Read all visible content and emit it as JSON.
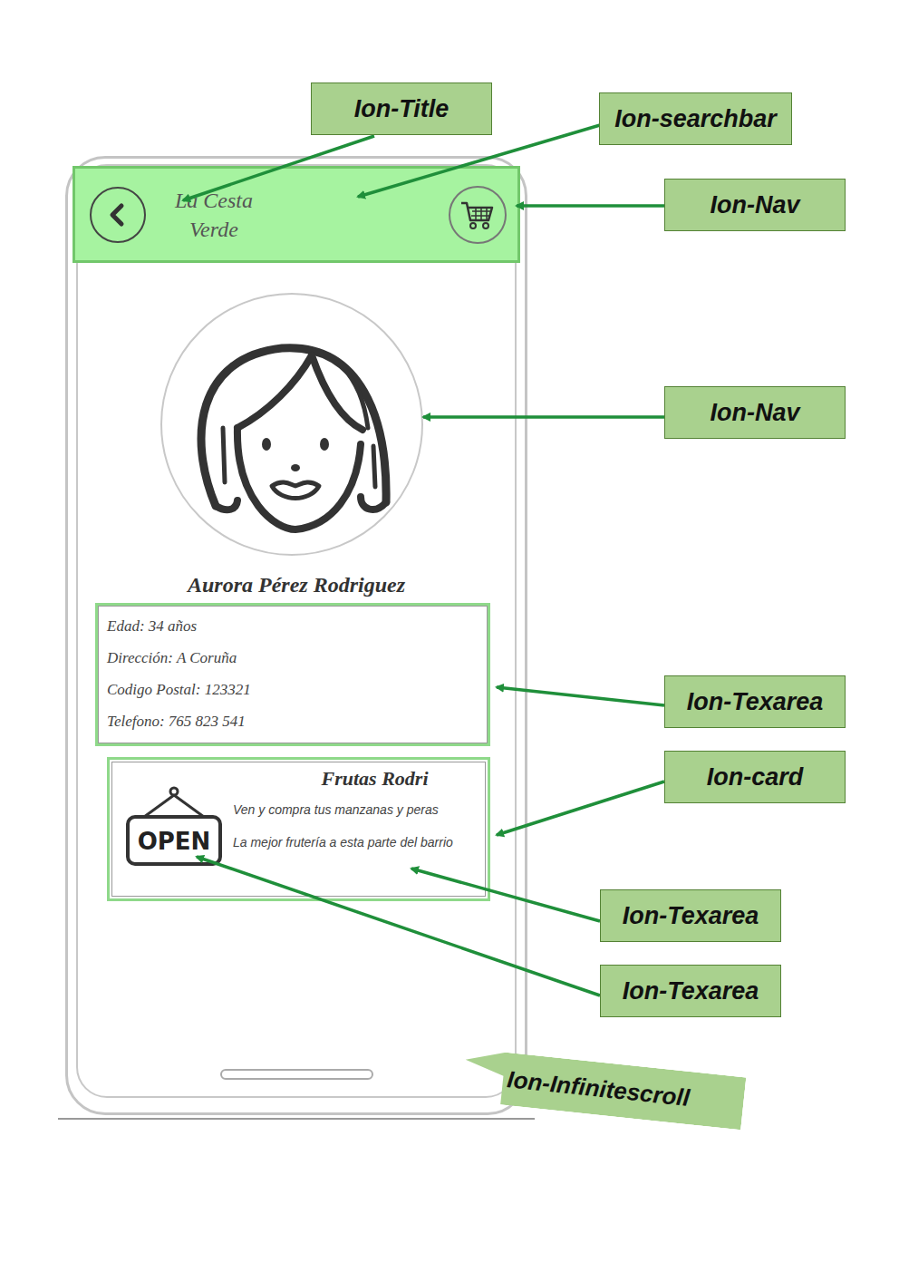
{
  "app": {
    "title": "La Cesta Verde"
  },
  "profile": {
    "name": "Aurora Pérez Rodriguez",
    "details": [
      "Edad: 34 años",
      "Dirección: A Coruña",
      "Codigo Postal: 123321",
      "Telefono: 765 823 541"
    ]
  },
  "card": {
    "title": "Frutas Rodri",
    "sign": "OPEN",
    "lines": [
      "Ven y compra tus manzanas y peras",
      "La mejor frutería a esta parte del barrio"
    ]
  },
  "annotations": [
    {
      "label": "Ion-Title",
      "kind": "box"
    },
    {
      "label": "Ion-searchbar",
      "kind": "box"
    },
    {
      "label": "Ion-Nav",
      "kind": "box"
    },
    {
      "label": "Ion-Nav",
      "kind": "box"
    },
    {
      "label": "Ion-Texarea",
      "kind": "box"
    },
    {
      "label": "Ion-card",
      "kind": "box"
    },
    {
      "label": "Ion-Texarea",
      "kind": "box"
    },
    {
      "label": "Ion-Texarea",
      "kind": "box"
    },
    {
      "label": "Ion-Infinitescroll",
      "kind": "callout"
    }
  ]
}
